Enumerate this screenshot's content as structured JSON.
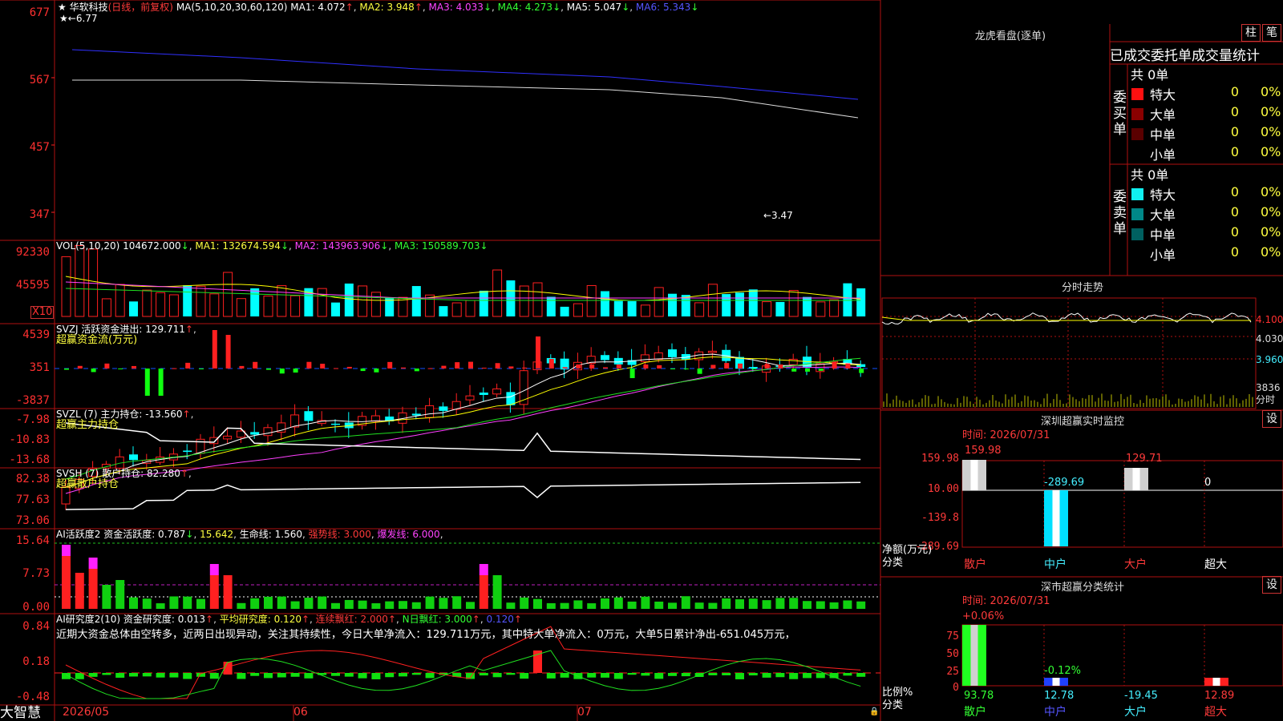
{
  "app": {
    "name": "大智慧"
  },
  "stock": {
    "name": "华软科技",
    "period": "(日线，前复权)",
    "hi_mark": "6.77",
    "lo_mark": "←3.47"
  },
  "ma_header": {
    "label": "MA(5,10,20,30,60,120)",
    "ma1": "MA1: 4.072",
    "ma2": "MA2: 3.948",
    "ma3": "MA3: 4.033",
    "ma4": "MA4: 4.273",
    "ma5": "MA5: 5.047",
    "ma6": "MA6: 5.343"
  },
  "price_axis": [
    "677",
    "567",
    "457",
    "347"
  ],
  "vol_header": {
    "label": "VOL(5,10,20)",
    "value": "104672.000",
    "ma1": "MA1: 132674.594",
    "ma2": "MA2: 143963.906",
    "ma3": "MA3: 150589.703"
  },
  "vol_axis": [
    "92330",
    "45595"
  ],
  "vol_unit": "X10",
  "svzj": {
    "label": "SVZJ  活跃资金进出: 129.711",
    "sub": "超赢资金流(万元)",
    "axis": [
      "4539",
      "351",
      "-3837"
    ]
  },
  "svzl": {
    "label": "SVZL (7) 主力持仓: -13.560",
    "sub": "超赢主力持仓",
    "axis": [
      "-7.98",
      "-10.83",
      "-13.68"
    ]
  },
  "svsh": {
    "label": "SVSH (7) 散户持仓: 82.280",
    "sub": "超赢散户持仓",
    "axis": [
      "82.38",
      "77.63",
      "73.06"
    ]
  },
  "ai_active": {
    "l1": "AI活跃度2 资金活跃度: 0.787",
    "l2": "15.642",
    "l3": "生命线: 1.560",
    "l4": "强势线: 3.000",
    "l5": "爆发线: 6.000",
    "axis": [
      "15.64",
      "7.73",
      "0.00"
    ]
  },
  "ai_research": {
    "l1": "AI研究度2(10) 资金研究度: 0.013",
    "l2": "平均研究度: 0.120",
    "l3": "连续飘红: 2.000",
    "l4": "N日飘红: 3.000",
    "l5": "0.120",
    "comment": "近期大资金总体由空转多，近两日出现异动，关注其持续性，今日大单净流入：129.711万元，其中特大单净流入：0万元，大单5日累计净出-651.045万元，",
    "axis": [
      "0.84",
      "0.18",
      "-0.48"
    ]
  },
  "date_axis": [
    "2026/05",
    "06",
    "07"
  ],
  "right": {
    "lhb_title": "龙虎看盘(逐单)",
    "btn_bar": "柱",
    "btn_bi": "笔",
    "stat_title": "已成交委托单成交量统计",
    "buy_label": "委买单",
    "sell_label": "委卖单",
    "buy_total": "共 0单",
    "sell_total": "共 0单",
    "rows": [
      {
        "name": "特大",
        "count": "0",
        "pct": "0%"
      },
      {
        "name": "大单",
        "count": "0",
        "pct": "0%"
      },
      {
        "name": "中单",
        "count": "0",
        "pct": "0%"
      },
      {
        "name": "小单",
        "count": "0",
        "pct": "0%"
      }
    ],
    "colors": {
      "buy": [
        "#ff1010",
        "#8a0000",
        "#5a0000"
      ],
      "sell": [
        "#10f0f0",
        "#008888",
        "#006060"
      ]
    },
    "fenshi_title": "分时走势",
    "fenshi_axis": [
      "4.100",
      "4.030",
      "3.960"
    ],
    "fenshi_vol": "3836",
    "fenshi_vol_label": "分时",
    "monitor_title": "深圳超赢实时监控",
    "monitor_time": "时间: 2026/07/31",
    "monitor_axis": [
      "159.98",
      "10.00",
      "-139.8",
      "-289.69"
    ],
    "monitor_values": [
      "159.98",
      "-289.69",
      "129.71",
      "0"
    ],
    "monitor_ylabel": "净额(万元)",
    "monitor_xlabel": "分类",
    "monitor_cats": [
      "散户",
      "中户",
      "大户",
      "超大"
    ],
    "class_title": "深市超赢分类统计",
    "class_time": "时间: 2026/07/31",
    "class_axis": [
      "75",
      "50",
      "25",
      "0"
    ],
    "class_top": [
      "+0.06%",
      "-0.12%"
    ],
    "class_ylabel": "比例%",
    "class_xlabel": "分类",
    "class_values": [
      "93.78",
      "12.78",
      "-19.45",
      "12.89"
    ],
    "class_cats": [
      "散户",
      "中户",
      "大户",
      "超大"
    ],
    "set": "设"
  }
}
